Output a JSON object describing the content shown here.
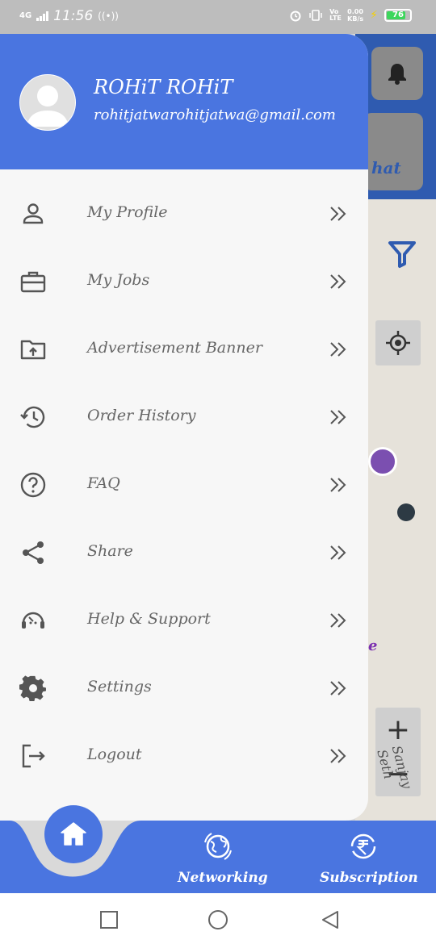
{
  "status_bar": {
    "time": "11:56",
    "network": "4G",
    "speed_value": "0.00",
    "speed_unit": "KB/s",
    "volte": "Vo LTE",
    "battery": "76"
  },
  "map": {
    "chat_label": "hat",
    "road_label": "Sanjay Seth",
    "place_letter": "e"
  },
  "drawer": {
    "user_name": "ROHiT ROHiT",
    "user_email": "rohitjatwarohitjatwa@gmail.com",
    "items": [
      {
        "label": "My Profile",
        "icon": "person-icon"
      },
      {
        "label": "My Jobs",
        "icon": "briefcase-icon"
      },
      {
        "label": "Advertisement Banner",
        "icon": "folder-upload-icon"
      },
      {
        "label": "Order History",
        "icon": "history-icon"
      },
      {
        "label": "FAQ",
        "icon": "help-circle-icon"
      },
      {
        "label": "Share",
        "icon": "share-icon"
      },
      {
        "label": "Help & Support",
        "icon": "support-agent-icon"
      },
      {
        "label": "Settings",
        "icon": "gear-icon"
      },
      {
        "label": "Logout",
        "icon": "logout-icon"
      }
    ]
  },
  "bottom_nav": {
    "networking": "Networking",
    "subscription": "Subscription"
  },
  "colors": {
    "primary": "#4a75e0",
    "drawer_bg": "#f7f7f7",
    "text_muted": "#666666"
  }
}
